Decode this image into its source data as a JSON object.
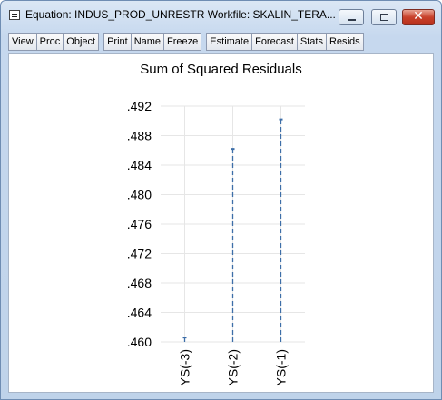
{
  "window": {
    "title": "Equation: INDUS_PROD_UNRESTR   Workfile: SKALIN_TERA...",
    "close_glyph": "✕"
  },
  "toolbar": {
    "buttons": [
      "View",
      "Proc",
      "Object",
      "Print",
      "Name",
      "Freeze",
      "Estimate",
      "Forecast",
      "Stats",
      "Resids"
    ]
  },
  "chart_data": {
    "type": "bar",
    "style": "dropline",
    "title": "Sum of Squared Residuals",
    "categories": [
      "YS(-3)",
      "YS(-2)",
      "YS(-1)"
    ],
    "values": [
      0.4606,
      0.4862,
      0.4902
    ],
    "ylim": [
      0.46,
      0.492
    ],
    "ytick_labels": [
      ".460",
      ".464",
      ".468",
      ".472",
      ".476",
      ".480",
      ".484",
      ".488",
      ".492"
    ],
    "yticks": [
      0.46,
      0.464,
      0.468,
      0.472,
      0.476,
      0.48,
      0.484,
      0.488,
      0.492
    ],
    "grid": true,
    "line_color": "#3d6ea8",
    "grid_color": "#e6e6e6"
  }
}
